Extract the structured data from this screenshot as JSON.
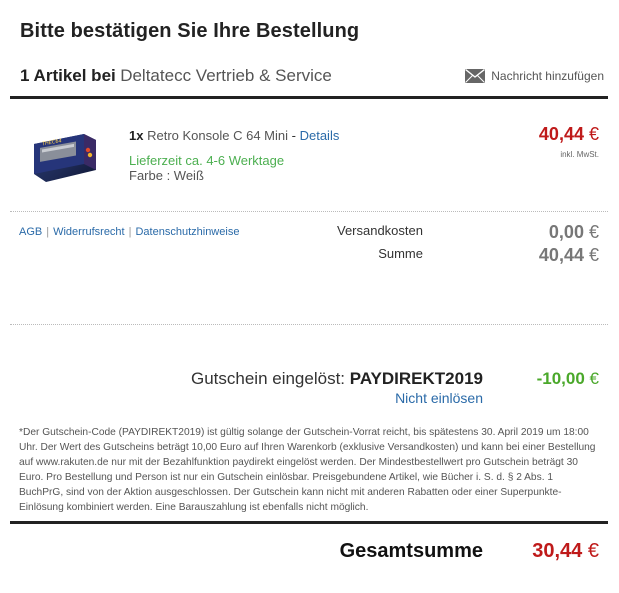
{
  "page_title": "Bitte bestätigen Sie Ihre Bestellung",
  "seller": {
    "count_label": "1 Artikel bei",
    "name": "Deltatecc Vertrieb & Service",
    "message_label": "Nachricht hinzufügen",
    "message_icon": "envelope-icon"
  },
  "item": {
    "qty": "1x",
    "name": "Retro Konsole C 64 Mini",
    "separator": "-",
    "details_label": "Details",
    "delivery": "Lieferzeit ca. 4-6 Werktage",
    "variant": "Farbe : Weiß",
    "price": "40,44",
    "currency": "€",
    "vat_note": "inkl. MwSt."
  },
  "links": {
    "agb": "AGB",
    "widerruf": "Widerrufsrecht",
    "datenschutz": "Datenschutzhinweise",
    "separator": "|"
  },
  "summary": {
    "shipping_label": "Versandkosten",
    "shipping_value": "0,00",
    "sum_label": "Summe",
    "sum_value": "40,44",
    "currency": "€"
  },
  "coupon": {
    "label": "Gutschein eingelöst:",
    "code": "PAYDIREKT2019",
    "value": "-10,00",
    "currency": "€",
    "remove_label": "Nicht einlösen",
    "disclaimer": "*Der Gutschein-Code (PAYDIREKT2019) ist gültig solange der Gutschein-Vorrat reicht, bis spätestens 30. April 2019 um 18:00 Uhr. Der Wert des Gutscheins beträgt 10,00 Euro auf Ihren Warenkorb (exklusive Versandkosten) und kann bei einer Bestellung auf www.rakuten.de nur mit der Bezahlfunktion paydirekt eingelöst werden. Der Mindestbestellwert pro Gutschein beträgt 30 Euro. Pro Bestellung und Person ist nur ein Gutschein einlösbar. Preisgebundene Artikel, wie Bücher i. S. d. § 2 Abs. 1 BuchPrG, sind von der Aktion ausgeschlossen. Der Gutschein kann nicht mit anderen Rabatten oder einer Superpunkte-Einlösung kombiniert werden. Eine Barauszahlung ist ebenfalls nicht möglich."
  },
  "total": {
    "label": "Gesamtsumme",
    "value": "30,44",
    "currency": "€"
  },
  "colors": {
    "price_red": "#bf1a1a",
    "discount_green": "#4aa82a",
    "delivery_green": "#4caf50",
    "link_blue": "#2a6aa8"
  }
}
